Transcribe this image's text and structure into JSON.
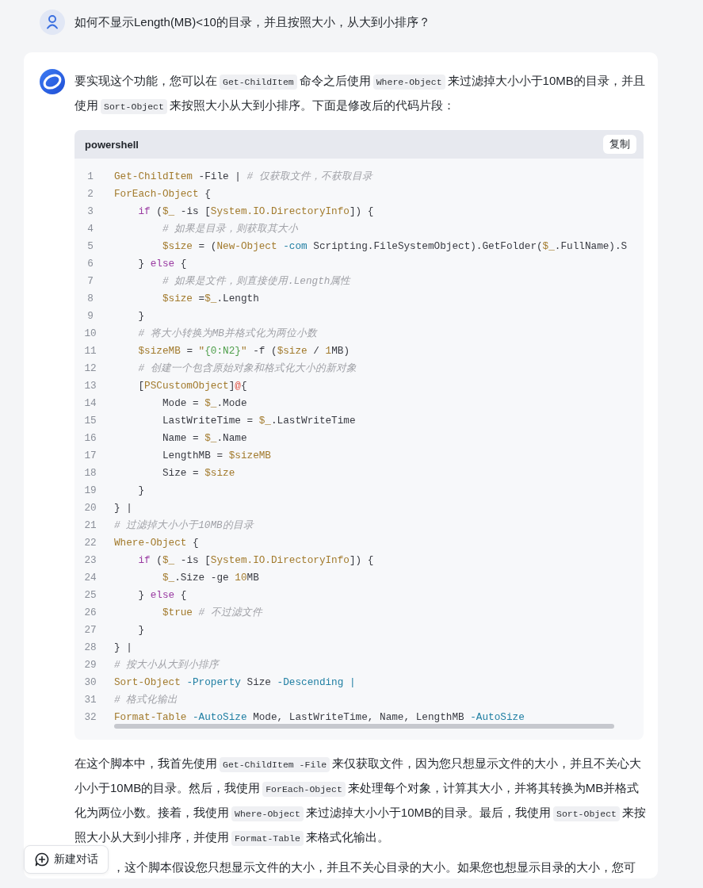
{
  "user_message": {
    "text": "如何不显示Length(MB)<10的目录，并且按照大小，从大到小排序？"
  },
  "reply": {
    "intro": [
      {
        "kind": "text",
        "text": "要实现这个功能，您可以在"
      },
      {
        "kind": "code",
        "text": "Get-ChildItem"
      },
      {
        "kind": "text",
        "text": "命令之后使用"
      },
      {
        "kind": "code",
        "text": "Where-Object"
      },
      {
        "kind": "text",
        "text": "来过滤掉大小小于10MB的目录，并且使用"
      },
      {
        "kind": "code",
        "text": "Sort-Object"
      },
      {
        "kind": "text",
        "text": "来按照大小从大到小排序。下面是修改后的代码片段："
      }
    ],
    "code_block": {
      "language": "powershell",
      "copy_label": "复制",
      "lines": [
        {
          "number": "1",
          "tokens": [
            {
              "kind": "cmdlet",
              "text": "Get-ChildItem"
            },
            {
              "kind": "plain",
              "text": " -File | "
            },
            {
              "kind": "comment",
              "text": "# 仅获取文件，不获取目录"
            }
          ]
        },
        {
          "number": "2",
          "tokens": [
            {
              "kind": "cmdlet",
              "text": "ForEach-Object"
            },
            {
              "kind": "plain",
              "text": " {"
            }
          ]
        },
        {
          "number": "3",
          "tokens": [
            {
              "kind": "keyword",
              "text": "    if"
            },
            {
              "kind": "plain",
              "text": " ("
            },
            {
              "kind": "var",
              "text": "$_"
            },
            {
              "kind": "plain",
              "text": " -is ["
            },
            {
              "kind": "type",
              "text": "System.IO.DirectoryInfo"
            },
            {
              "kind": "plain",
              "text": "]) {"
            }
          ]
        },
        {
          "number": "4",
          "tokens": [
            {
              "kind": "comment",
              "text": "        # 如果是目录，则获取其大小"
            }
          ]
        },
        {
          "number": "5",
          "tokens": [
            {
              "kind": "var",
              "text": "        $size"
            },
            {
              "kind": "plain",
              "text": " = ("
            },
            {
              "kind": "cmdlet",
              "text": "New-Object"
            },
            {
              "kind": "param",
              "text": " -com"
            },
            {
              "kind": "plain",
              "text": " Scripting.FileSystemObject).GetFolder("
            },
            {
              "kind": "var",
              "text": "$_"
            },
            {
              "kind": "plain",
              "text": ".FullName).S"
            }
          ]
        },
        {
          "number": "6",
          "tokens": [
            {
              "kind": "plain",
              "text": "    } "
            },
            {
              "kind": "keyword",
              "text": "else"
            },
            {
              "kind": "plain",
              "text": " {"
            }
          ]
        },
        {
          "number": "7",
          "tokens": [
            {
              "kind": "comment",
              "text": "        # 如果是文件，则直接使用.Length属性"
            }
          ]
        },
        {
          "number": "8",
          "tokens": [
            {
              "kind": "var",
              "text": "        $size"
            },
            {
              "kind": "plain",
              "text": " ="
            },
            {
              "kind": "var",
              "text": "$_"
            },
            {
              "kind": "plain",
              "text": ".Length"
            }
          ]
        },
        {
          "number": "9",
          "tokens": [
            {
              "kind": "plain",
              "text": "    }"
            }
          ]
        },
        {
          "number": "10",
          "tokens": [
            {
              "kind": "comment",
              "text": "    # 将大小转换为MB并格式化为两位小数"
            }
          ]
        },
        {
          "number": "11",
          "tokens": [
            {
              "kind": "var",
              "text": "    $sizeMB"
            },
            {
              "kind": "plain",
              "text": " = "
            },
            {
              "kind": "quote",
              "text": "\""
            },
            {
              "kind": "string",
              "text": "{0:N2}"
            },
            {
              "kind": "quote",
              "text": "\""
            },
            {
              "kind": "plain",
              "text": " -f ("
            },
            {
              "kind": "var",
              "text": "$size"
            },
            {
              "kind": "plain",
              "text": " / "
            },
            {
              "kind": "number",
              "text": "1"
            },
            {
              "kind": "plain",
              "text": "MB)"
            }
          ]
        },
        {
          "number": "12",
          "tokens": [
            {
              "kind": "comment",
              "text": "    # 创建一个包含原始对象和格式化大小的新对象"
            }
          ]
        },
        {
          "number": "13",
          "tokens": [
            {
              "kind": "plain",
              "text": "    ["
            },
            {
              "kind": "type",
              "text": "PSCustomObject"
            },
            {
              "kind": "plain",
              "text": "]"
            },
            {
              "kind": "symbol",
              "text": "@"
            },
            {
              "kind": "plain",
              "text": "{"
            }
          ]
        },
        {
          "number": "14",
          "tokens": [
            {
              "kind": "plain",
              "text": "        Mode = "
            },
            {
              "kind": "var",
              "text": "$_"
            },
            {
              "kind": "plain",
              "text": ".Mode"
            }
          ]
        },
        {
          "number": "15",
          "tokens": [
            {
              "kind": "plain",
              "text": "        LastWriteTime = "
            },
            {
              "kind": "var",
              "text": "$_"
            },
            {
              "kind": "plain",
              "text": ".LastWriteTime"
            }
          ]
        },
        {
          "number": "16",
          "tokens": [
            {
              "kind": "plain",
              "text": "        Name = "
            },
            {
              "kind": "var",
              "text": "$_"
            },
            {
              "kind": "plain",
              "text": ".Name"
            }
          ]
        },
        {
          "number": "17",
          "tokens": [
            {
              "kind": "plain",
              "text": "        LengthMB = "
            },
            {
              "kind": "var",
              "text": "$sizeMB"
            }
          ]
        },
        {
          "number": "18",
          "tokens": [
            {
              "kind": "plain",
              "text": "        Size = "
            },
            {
              "kind": "var",
              "text": "$size"
            }
          ]
        },
        {
          "number": "19",
          "tokens": [
            {
              "kind": "plain",
              "text": "    }"
            }
          ]
        },
        {
          "number": "20",
          "tokens": [
            {
              "kind": "plain",
              "text": "} |"
            }
          ]
        },
        {
          "number": "21",
          "tokens": [
            {
              "kind": "comment",
              "text": "# 过滤掉大小小于10MB的目录"
            }
          ]
        },
        {
          "number": "22",
          "tokens": [
            {
              "kind": "cmdlet",
              "text": "Where-Object"
            },
            {
              "kind": "plain",
              "text": " {"
            }
          ]
        },
        {
          "number": "23",
          "tokens": [
            {
              "kind": "keyword",
              "text": "    if"
            },
            {
              "kind": "plain",
              "text": " ("
            },
            {
              "kind": "var",
              "text": "$_"
            },
            {
              "kind": "plain",
              "text": " -is ["
            },
            {
              "kind": "type",
              "text": "System.IO.DirectoryInfo"
            },
            {
              "kind": "plain",
              "text": "]) {"
            }
          ]
        },
        {
          "number": "24",
          "tokens": [
            {
              "kind": "var",
              "text": "        $_"
            },
            {
              "kind": "plain",
              "text": ".Size -ge "
            },
            {
              "kind": "number",
              "text": "10"
            },
            {
              "kind": "plain",
              "text": "MB"
            }
          ]
        },
        {
          "number": "25",
          "tokens": [
            {
              "kind": "plain",
              "text": "    } "
            },
            {
              "kind": "keyword",
              "text": "else"
            },
            {
              "kind": "plain",
              "text": " {"
            }
          ]
        },
        {
          "number": "26",
          "tokens": [
            {
              "kind": "var",
              "text": "        $true"
            },
            {
              "kind": "comment",
              "text": " # 不过滤文件"
            }
          ]
        },
        {
          "number": "27",
          "tokens": [
            {
              "kind": "plain",
              "text": "    }"
            }
          ]
        },
        {
          "number": "28",
          "tokens": [
            {
              "kind": "plain",
              "text": "} |"
            }
          ]
        },
        {
          "number": "29",
          "tokens": [
            {
              "kind": "comment",
              "text": "# 按大小从大到小排序"
            }
          ]
        },
        {
          "number": "30",
          "tokens": [
            {
              "kind": "cmdlet",
              "text": "Sort-Object"
            },
            {
              "kind": "param",
              "text": " -Property"
            },
            {
              "kind": "plain",
              "text": " Size"
            },
            {
              "kind": "param",
              "text": " -Descending |"
            }
          ]
        },
        {
          "number": "31",
          "tokens": [
            {
              "kind": "comment",
              "text": "# 格式化输出"
            }
          ]
        },
        {
          "number": "32",
          "tokens": [
            {
              "kind": "cmdlet",
              "text": "Format-Table"
            },
            {
              "kind": "param",
              "text": " -AutoSize"
            },
            {
              "kind": "plain",
              "text": " Mode, LastWriteTime, Name, LengthMB"
            },
            {
              "kind": "param",
              "text": " -AutoSize"
            }
          ]
        }
      ]
    },
    "explanation": [
      {
        "kind": "text",
        "text": "在这个脚本中，我首先使用"
      },
      {
        "kind": "code",
        "text": "Get-ChildItem -File"
      },
      {
        "kind": "text",
        "text": "来仅获取文件，因为您只想显示文件的大小，并且不关心大小小于10MB的目录。然后，我使用"
      },
      {
        "kind": "code",
        "text": "ForEach-Object"
      },
      {
        "kind": "text",
        "text": "来处理每个对象，计算其大小，并将其转换为MB并格式化为两位小数。接着，我使用"
      },
      {
        "kind": "code",
        "text": "Where-Object"
      },
      {
        "kind": "text",
        "text": "来过滤掉大小小于10MB的目录。最后，我使用"
      },
      {
        "kind": "code",
        "text": "Sort-Object"
      },
      {
        "kind": "text",
        "text": "来按照大小从大到小排序，并使用"
      },
      {
        "kind": "code",
        "text": "Format-Table"
      },
      {
        "kind": "text",
        "text": "来格式化输出。"
      }
    ],
    "note": [
      {
        "kind": "text",
        "text": "，这个脚本假设您只想显示文件的大小，并且不关心目录的大小。如果您也想显示目录的大小，您可"
      }
    ]
  },
  "new_chat_button": {
    "label": "新建对话"
  }
}
